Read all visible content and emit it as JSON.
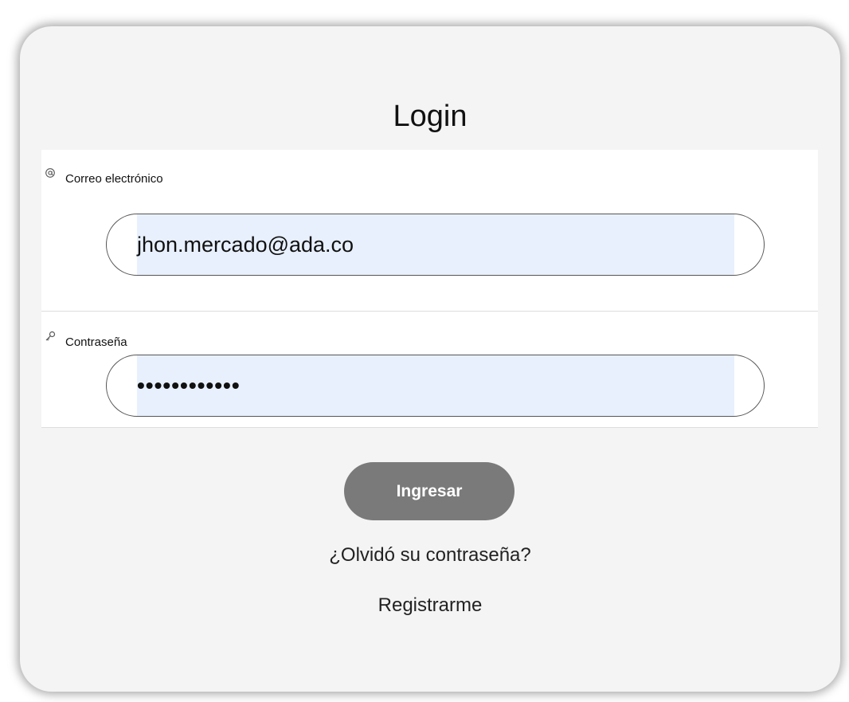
{
  "login": {
    "title": "Login",
    "email": {
      "icon": "at-icon",
      "label": "Correo electrónico",
      "value": "jhon.mercado@ada.co"
    },
    "password": {
      "icon": "key-icon",
      "label": "Contraseña",
      "value": "••••••••••••"
    },
    "submit_label": "Ingresar",
    "forgot_label": "¿Olvidó su contraseña?",
    "register_label": "Registrarme"
  },
  "colors": {
    "card_bg": "#f4f4f4",
    "autofill_bg": "#e8f0fe",
    "button_bg": "#7a7a7a"
  }
}
